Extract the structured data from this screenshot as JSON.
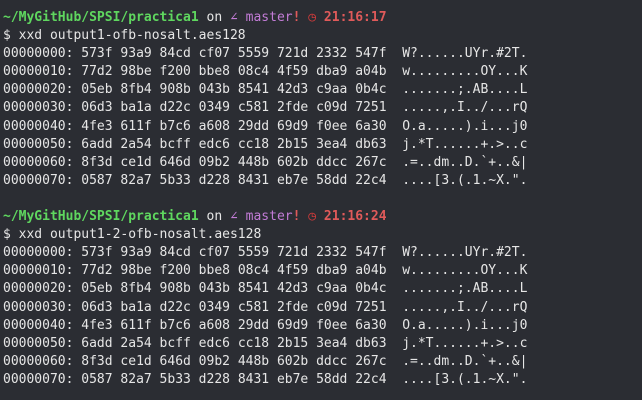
{
  "colors": {
    "background": "#2b2d33",
    "path": "#5fd75f",
    "branch": "#c27cd6",
    "time": "#e05a5a",
    "text": "#e6e6e6"
  },
  "blocks": [
    {
      "prompt": {
        "path": "~/MyGitHub/SPSI/practica1",
        "on": " on ",
        "branch_icon": "∠",
        "branch": " master",
        "dirty": "!",
        "clock_icon": "◷",
        "time": "21:16:17"
      },
      "command": "$ xxd output1-ofb-nosalt.aes128",
      "rows": [
        {
          "offset": "00000000:",
          "hex": "573f 93a9 84cd cf07 5559 721d 2332 547f",
          "ascii": "W?......UYr.#2T."
        },
        {
          "offset": "00000010:",
          "hex": "77d2 98be f200 bbe8 08c4 4f59 dba9 a04b",
          "ascii": "w.........OY...K"
        },
        {
          "offset": "00000020:",
          "hex": "05eb 8fb4 908b 043b 8541 42d3 c9aa 0b4c",
          "ascii": ".......;.AB....L"
        },
        {
          "offset": "00000030:",
          "hex": "06d3 ba1a d22c 0349 c581 2fde c09d 7251",
          "ascii": ".....,.I../...rQ"
        },
        {
          "offset": "00000040:",
          "hex": "4fe3 611f b7c6 a608 29dd 69d9 f0ee 6a30",
          "ascii": "O.a.....).i...j0"
        },
        {
          "offset": "00000050:",
          "hex": "6add 2a54 bcff edc6 cc18 2b15 3ea4 db63",
          "ascii": "j.*T......+.>..c"
        },
        {
          "offset": "00000060:",
          "hex": "8f3d ce1d 646d 09b2 448b 602b ddcc 267c",
          "ascii": ".=..dm..D.`+..&|"
        },
        {
          "offset": "00000070:",
          "hex": "0587 82a7 5b33 d228 8431 eb7e 58dd 22c4",
          "ascii": "....[3.(.1.~X.\"."
        }
      ]
    },
    {
      "prompt": {
        "path": "~/MyGitHub/SPSI/practica1",
        "on": " on ",
        "branch_icon": "∠",
        "branch": " master",
        "dirty": "!",
        "clock_icon": "◷",
        "time": "21:16:24"
      },
      "command": "$ xxd output1-2-ofb-nosalt.aes128",
      "rows": [
        {
          "offset": "00000000:",
          "hex": "573f 93a9 84cd cf07 5559 721d 2332 547f",
          "ascii": "W?......UYr.#2T."
        },
        {
          "offset": "00000010:",
          "hex": "77d2 98be f200 bbe8 08c4 4f59 dba9 a04b",
          "ascii": "w.........OY...K"
        },
        {
          "offset": "00000020:",
          "hex": "05eb 8fb4 908b 043b 8541 42d3 c9aa 0b4c",
          "ascii": ".......;.AB....L"
        },
        {
          "offset": "00000030:",
          "hex": "06d3 ba1a d22c 0349 c581 2fde c09d 7251",
          "ascii": ".....,.I../...rQ"
        },
        {
          "offset": "00000040:",
          "hex": "4fe3 611f b7c6 a608 29dd 69d9 f0ee 6a30",
          "ascii": "O.a.....).i...j0"
        },
        {
          "offset": "00000050:",
          "hex": "6add 2a54 bcff edc6 cc18 2b15 3ea4 db63",
          "ascii": "j.*T......+.>..c"
        },
        {
          "offset": "00000060:",
          "hex": "8f3d ce1d 646d 09b2 448b 602b ddcc 267c",
          "ascii": ".=..dm..D.`+..&|"
        },
        {
          "offset": "00000070:",
          "hex": "0587 82a7 5b33 d228 8431 eb7e 58dd 22c4",
          "ascii": "....[3.(.1.~X.\"."
        }
      ]
    }
  ]
}
